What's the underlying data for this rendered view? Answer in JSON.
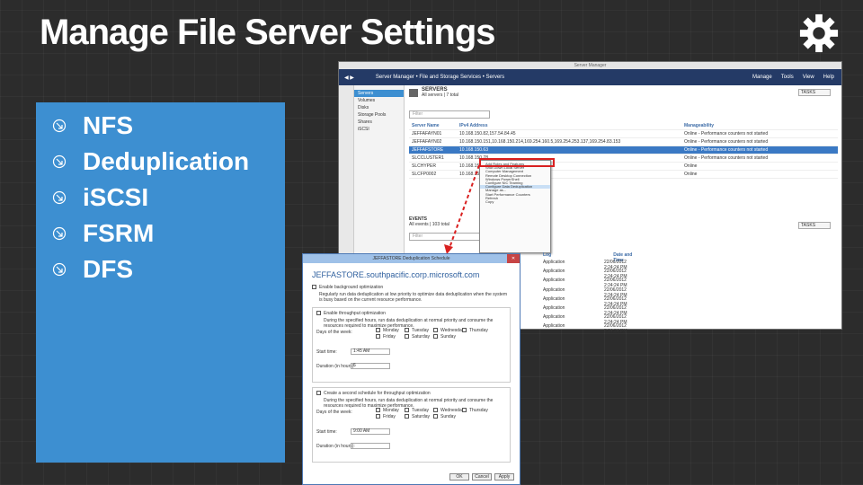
{
  "slide": {
    "title": "Manage File Server Settings",
    "bullets": [
      "NFS",
      "Deduplication",
      "iSCSI",
      "FSRM",
      "DFS"
    ],
    "bullet_icon": "arrow-down-right-icon",
    "accent": "#3d8fd1"
  },
  "server_manager": {
    "window_title": "Server Manager",
    "breadcrumb": "Server Manager • File and Storage Services • Servers",
    "menu": [
      "Manage",
      "Tools",
      "View",
      "Help"
    ],
    "sidebar": [
      "Servers",
      "Volumes",
      "Disks",
      "Storage Pools",
      "Shares",
      "iSCSI"
    ],
    "servers_heading": "SERVERS",
    "servers_count": "All servers | 7 total",
    "tasks_label": "TASKS",
    "filter_placeholder": "Filter",
    "columns": [
      "Server Name",
      "IPv4 Address",
      "Manageability"
    ],
    "rows": [
      {
        "name": "JEFFAFAYN01",
        "ip": "10.168.150.82,157.54.84.45",
        "status": "Online - Performance counters not started"
      },
      {
        "name": "JEFFAFAYN02",
        "ip": "10.168.150.151,10.168.150.214,169.254.160.5,169.254.253.137,169.254.83.153",
        "status": "Online - Performance counters not started"
      },
      {
        "name": "JEFFAFSTORE",
        "ip": "10.168.150.63",
        "status": "Online - Performance counters not started"
      },
      {
        "name": "SLCCLUSTER1",
        "ip": "10.168.150.78",
        "status": "Online - Performance counters not started"
      },
      {
        "name": "SLCHYPER",
        "ip": "10.168.150.89",
        "status": "Online"
      },
      {
        "name": "SLCFP0002",
        "ip": "10.168.150.144",
        "status": "Online"
      }
    ],
    "selected_row": 2,
    "context_menu": [
      "Add Roles and Features",
      "Shut Down Local Server",
      "Computer Management",
      "Remote Desktop Connection",
      "Windows PowerShell",
      "Configure NIC Teaming",
      "Configure Data Deduplication",
      "Manage as...",
      "Start Performance Counters",
      "Refresh",
      "Copy"
    ],
    "events_heading": "EVENTS",
    "events_count": "All events | 103 total"
  },
  "events": {
    "columns": [
      "Log",
      "Date and Time"
    ],
    "rows": [
      {
        "log": "Application",
        "date": "22/06/2012 2:24:24 PM"
      },
      {
        "log": "Application",
        "date": "22/06/2012 2:24:24 PM"
      },
      {
        "log": "Application",
        "date": "22/06/2012 2:24:24 PM"
      },
      {
        "log": "Application",
        "date": "22/06/2012 2:24:24 PM"
      },
      {
        "log": "Application",
        "date": "22/06/2012 2:24:24 PM"
      },
      {
        "log": "Application",
        "date": "22/06/2012 2:24:24 PM"
      },
      {
        "log": "Application",
        "date": "22/06/2012 2:24:24 PM"
      },
      {
        "log": "Application",
        "date": "22/06/2012 2:24:24 PM"
      }
    ]
  },
  "dialog": {
    "title": "JEFFASTORE Deduplication Schedule",
    "host": "JEFFASTORE.southpacific.corp.microsoft.com",
    "enable_label": "Enable background optimization",
    "enable_desc": "Regularly run data deduplication at low priority to optimize data deduplication when the system is busy based on the current resource performance.",
    "section1_label": "Enable throughput optimization",
    "section2_label": "Create a second schedule for throughput optimization",
    "section_desc": "During the specified hours, run data deduplication at normal priority and consume the resources required to maximize performance.",
    "days_label": "Days of the week:",
    "days": [
      "Sunday",
      "Monday",
      "Tuesday",
      "Wednesday",
      "Thursday",
      "Friday",
      "Saturday"
    ],
    "start_label": "Start time:",
    "start_value": "1:45 AM",
    "start_value2": "9:00 AM",
    "duration_label": "Duration (in hours):",
    "duration_value": "6",
    "buttons": [
      "OK",
      "Cancel",
      "Apply"
    ]
  }
}
